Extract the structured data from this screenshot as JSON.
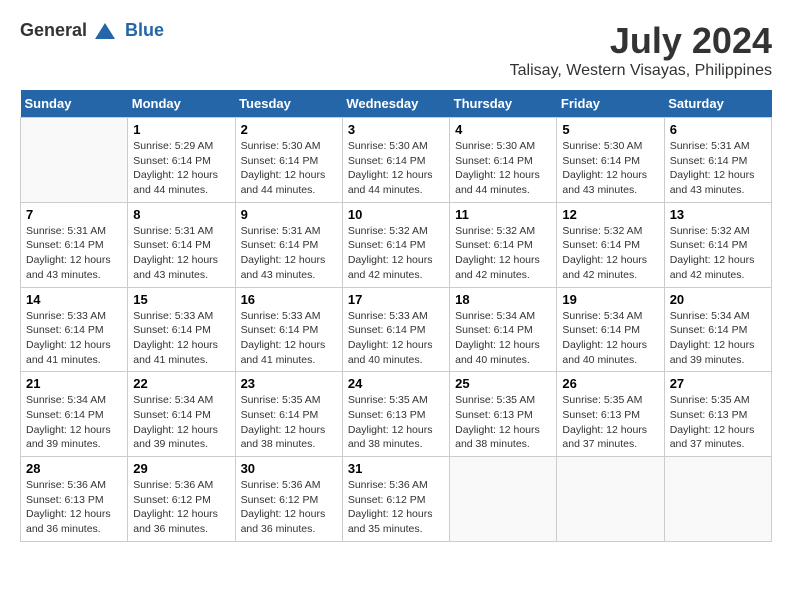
{
  "header": {
    "logo_general": "General",
    "logo_blue": "Blue",
    "month_title": "July 2024",
    "location": "Talisay, Western Visayas, Philippines"
  },
  "calendar": {
    "days_of_week": [
      "Sunday",
      "Monday",
      "Tuesday",
      "Wednesday",
      "Thursday",
      "Friday",
      "Saturday"
    ],
    "weeks": [
      [
        {
          "day": "",
          "content": ""
        },
        {
          "day": "1",
          "content": "Sunrise: 5:29 AM\nSunset: 6:14 PM\nDaylight: 12 hours\nand 44 minutes."
        },
        {
          "day": "2",
          "content": "Sunrise: 5:30 AM\nSunset: 6:14 PM\nDaylight: 12 hours\nand 44 minutes."
        },
        {
          "day": "3",
          "content": "Sunrise: 5:30 AM\nSunset: 6:14 PM\nDaylight: 12 hours\nand 44 minutes."
        },
        {
          "day": "4",
          "content": "Sunrise: 5:30 AM\nSunset: 6:14 PM\nDaylight: 12 hours\nand 44 minutes."
        },
        {
          "day": "5",
          "content": "Sunrise: 5:30 AM\nSunset: 6:14 PM\nDaylight: 12 hours\nand 43 minutes."
        },
        {
          "day": "6",
          "content": "Sunrise: 5:31 AM\nSunset: 6:14 PM\nDaylight: 12 hours\nand 43 minutes."
        }
      ],
      [
        {
          "day": "7",
          "content": "Sunrise: 5:31 AM\nSunset: 6:14 PM\nDaylight: 12 hours\nand 43 minutes."
        },
        {
          "day": "8",
          "content": "Sunrise: 5:31 AM\nSunset: 6:14 PM\nDaylight: 12 hours\nand 43 minutes."
        },
        {
          "day": "9",
          "content": "Sunrise: 5:31 AM\nSunset: 6:14 PM\nDaylight: 12 hours\nand 43 minutes."
        },
        {
          "day": "10",
          "content": "Sunrise: 5:32 AM\nSunset: 6:14 PM\nDaylight: 12 hours\nand 42 minutes."
        },
        {
          "day": "11",
          "content": "Sunrise: 5:32 AM\nSunset: 6:14 PM\nDaylight: 12 hours\nand 42 minutes."
        },
        {
          "day": "12",
          "content": "Sunrise: 5:32 AM\nSunset: 6:14 PM\nDaylight: 12 hours\nand 42 minutes."
        },
        {
          "day": "13",
          "content": "Sunrise: 5:32 AM\nSunset: 6:14 PM\nDaylight: 12 hours\nand 42 minutes."
        }
      ],
      [
        {
          "day": "14",
          "content": "Sunrise: 5:33 AM\nSunset: 6:14 PM\nDaylight: 12 hours\nand 41 minutes."
        },
        {
          "day": "15",
          "content": "Sunrise: 5:33 AM\nSunset: 6:14 PM\nDaylight: 12 hours\nand 41 minutes."
        },
        {
          "day": "16",
          "content": "Sunrise: 5:33 AM\nSunset: 6:14 PM\nDaylight: 12 hours\nand 41 minutes."
        },
        {
          "day": "17",
          "content": "Sunrise: 5:33 AM\nSunset: 6:14 PM\nDaylight: 12 hours\nand 40 minutes."
        },
        {
          "day": "18",
          "content": "Sunrise: 5:34 AM\nSunset: 6:14 PM\nDaylight: 12 hours\nand 40 minutes."
        },
        {
          "day": "19",
          "content": "Sunrise: 5:34 AM\nSunset: 6:14 PM\nDaylight: 12 hours\nand 40 minutes."
        },
        {
          "day": "20",
          "content": "Sunrise: 5:34 AM\nSunset: 6:14 PM\nDaylight: 12 hours\nand 39 minutes."
        }
      ],
      [
        {
          "day": "21",
          "content": "Sunrise: 5:34 AM\nSunset: 6:14 PM\nDaylight: 12 hours\nand 39 minutes."
        },
        {
          "day": "22",
          "content": "Sunrise: 5:34 AM\nSunset: 6:14 PM\nDaylight: 12 hours\nand 39 minutes."
        },
        {
          "day": "23",
          "content": "Sunrise: 5:35 AM\nSunset: 6:14 PM\nDaylight: 12 hours\nand 38 minutes."
        },
        {
          "day": "24",
          "content": "Sunrise: 5:35 AM\nSunset: 6:13 PM\nDaylight: 12 hours\nand 38 minutes."
        },
        {
          "day": "25",
          "content": "Sunrise: 5:35 AM\nSunset: 6:13 PM\nDaylight: 12 hours\nand 38 minutes."
        },
        {
          "day": "26",
          "content": "Sunrise: 5:35 AM\nSunset: 6:13 PM\nDaylight: 12 hours\nand 37 minutes."
        },
        {
          "day": "27",
          "content": "Sunrise: 5:35 AM\nSunset: 6:13 PM\nDaylight: 12 hours\nand 37 minutes."
        }
      ],
      [
        {
          "day": "28",
          "content": "Sunrise: 5:36 AM\nSunset: 6:13 PM\nDaylight: 12 hours\nand 36 minutes."
        },
        {
          "day": "29",
          "content": "Sunrise: 5:36 AM\nSunset: 6:12 PM\nDaylight: 12 hours\nand 36 minutes."
        },
        {
          "day": "30",
          "content": "Sunrise: 5:36 AM\nSunset: 6:12 PM\nDaylight: 12 hours\nand 36 minutes."
        },
        {
          "day": "31",
          "content": "Sunrise: 5:36 AM\nSunset: 6:12 PM\nDaylight: 12 hours\nand 35 minutes."
        },
        {
          "day": "",
          "content": ""
        },
        {
          "day": "",
          "content": ""
        },
        {
          "day": "",
          "content": ""
        }
      ]
    ]
  }
}
